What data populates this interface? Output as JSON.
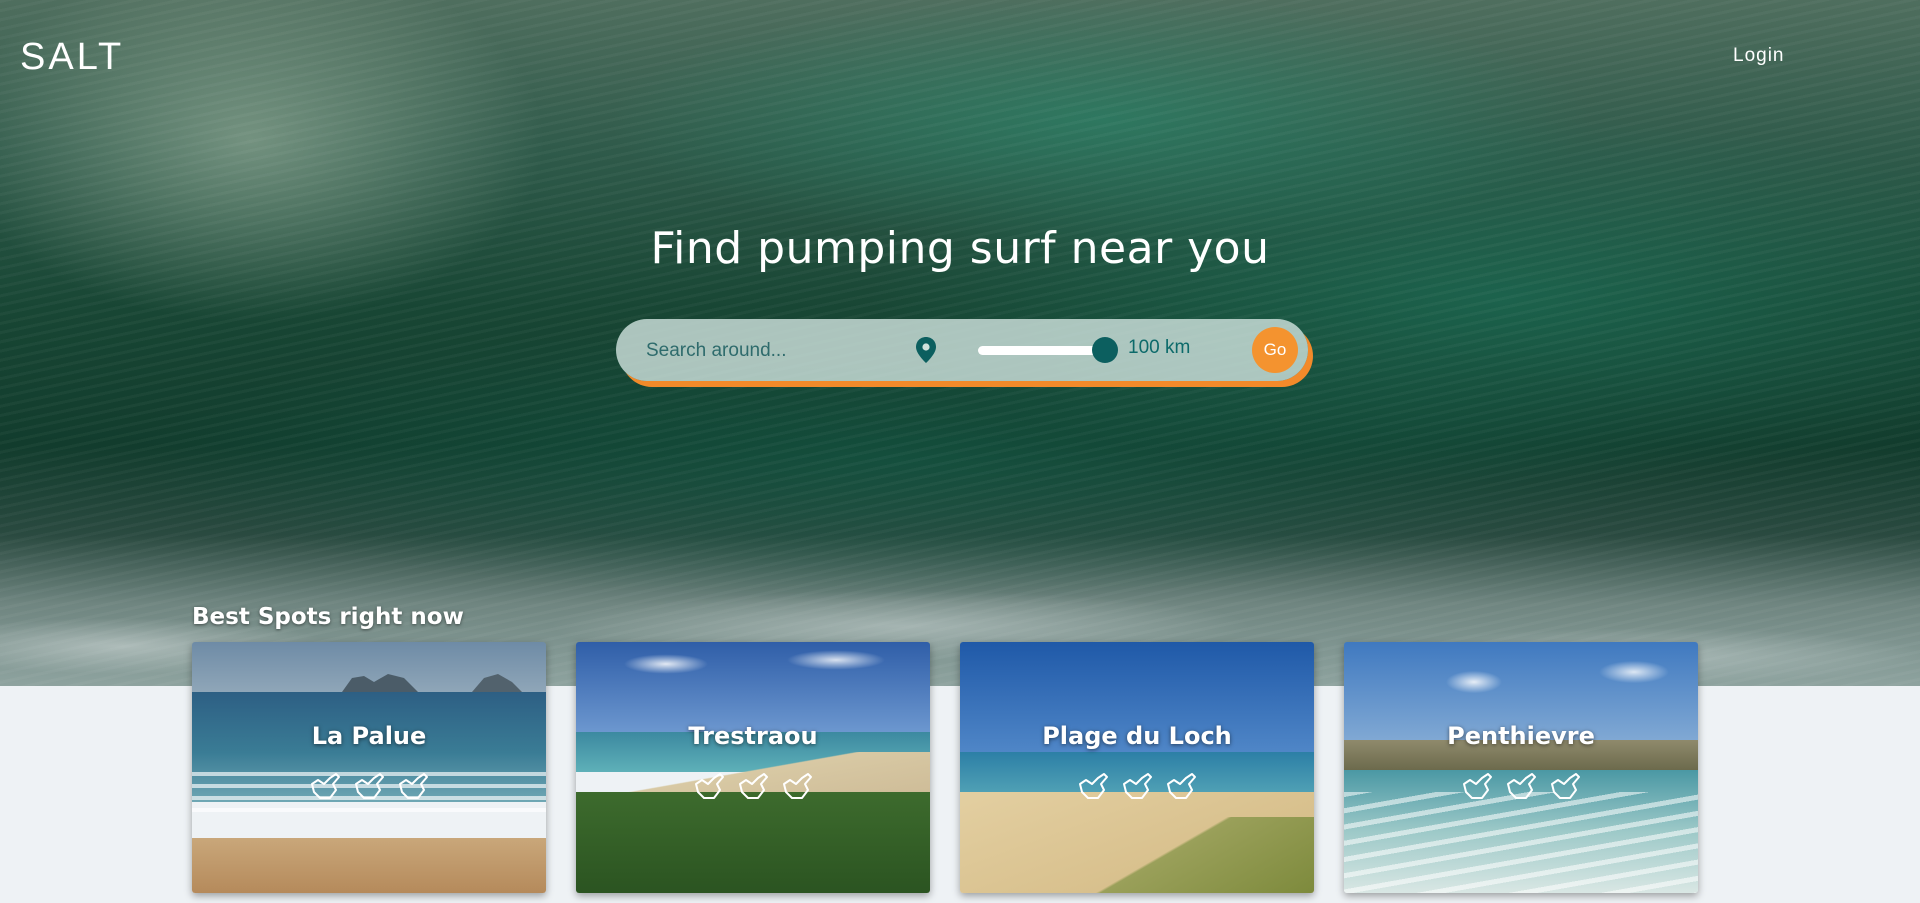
{
  "brand": {
    "logo": "SALT"
  },
  "nav": {
    "login": "Login"
  },
  "hero": {
    "headline": "Find pumping surf near you"
  },
  "search": {
    "placeholder": "Search around...",
    "radius_label": "100 km",
    "radius_fraction": 1.0,
    "go_label": "Go",
    "colors": {
      "accent": "#f4932f",
      "thumb": "#0c5f5f"
    }
  },
  "best_spots": {
    "title": "Best Spots right now",
    "spots": [
      {
        "name": "La Palue",
        "rating": 3
      },
      {
        "name": "Trestraou",
        "rating": 3
      },
      {
        "name": "Plage du Loch",
        "rating": 3
      },
      {
        "name": "Penthievre",
        "rating": 3
      }
    ]
  }
}
